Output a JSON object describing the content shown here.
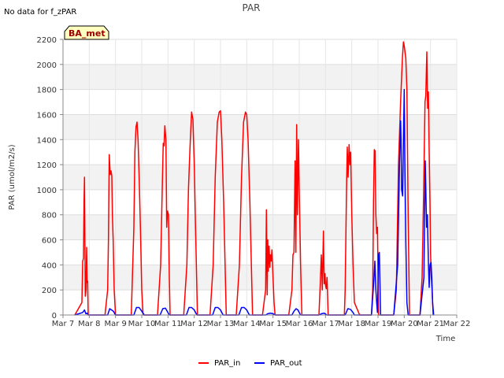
{
  "chart_data": {
    "type": "line",
    "title": "PAR",
    "note": "No data for f_zPAR",
    "badge": "BA_met",
    "xlabel": "Time",
    "ylabel": "PAR (umol/m2/s)",
    "xlim": [
      7,
      22
    ],
    "ylim": [
      0,
      2200
    ],
    "x_ticks": [
      7,
      8,
      9,
      10,
      11,
      12,
      13,
      14,
      15,
      16,
      17,
      18,
      19,
      20,
      21,
      22
    ],
    "x_tick_labels": [
      "Mar 7",
      "Mar 8",
      "Mar 9",
      "Mar 10",
      "Mar 11",
      "Mar 12",
      "Mar 13",
      "Mar 14",
      "Mar 15",
      "Mar 16",
      "Mar 17",
      "Mar 18",
      "Mar 19",
      "Mar 20",
      "Mar 21",
      "Mar 22"
    ],
    "y_ticks": [
      0,
      200,
      400,
      600,
      800,
      1000,
      1200,
      1400,
      1600,
      1800,
      2000,
      2200
    ],
    "y_tick_labels": [
      "0",
      "200",
      "400",
      "600",
      "800",
      "1000",
      "1200",
      "1400",
      "1600",
      "1800",
      "2000",
      "2200"
    ],
    "grid": true,
    "legend_position": "bottom-center",
    "series": [
      {
        "name": "PAR_in",
        "color": "#ff0000",
        "x": [
          7.45,
          7.72,
          7.75,
          7.78,
          7.8,
          7.82,
          7.85,
          7.88,
          7.9,
          7.92,
          7.94,
          7.96,
          8.0,
          8.02,
          8.05,
          8.08,
          8.1,
          8.3,
          8.6,
          8.7,
          8.73,
          8.76,
          8.8,
          8.83,
          8.86,
          8.88,
          8.91,
          8.95,
          9.0,
          9.1,
          9.3,
          9.6,
          9.7,
          9.74,
          9.78,
          9.82,
          9.86,
          9.9,
          9.95,
          10.0,
          10.05,
          10.1,
          10.3,
          10.6,
          10.72,
          10.78,
          10.82,
          10.85,
          10.88,
          10.92,
          10.95,
          10.98,
          11.02,
          11.05,
          11.08,
          11.3,
          11.6,
          11.72,
          11.78,
          11.82,
          11.85,
          11.9,
          11.95,
          12.0,
          12.05,
          12.12,
          12.22,
          12.35,
          12.6,
          12.72,
          12.8,
          12.88,
          12.95,
          13.0,
          13.05,
          13.12,
          13.22,
          13.35,
          13.6,
          13.72,
          13.8,
          13.88,
          13.95,
          14.0,
          14.05,
          14.12,
          14.22,
          14.35,
          14.6,
          14.72,
          14.75,
          14.78,
          14.8,
          14.82,
          14.85,
          14.88,
          14.9,
          14.93,
          14.96,
          15.0,
          15.04,
          15.08,
          15.12,
          15.3,
          15.6,
          15.72,
          15.76,
          15.8,
          15.84,
          15.87,
          15.9,
          15.93,
          15.97,
          16.0,
          16.05,
          16.1,
          16.3,
          16.6,
          16.75,
          16.8,
          16.84,
          16.88,
          16.92,
          16.95,
          16.98,
          17.0,
          17.03,
          17.06,
          17.1,
          17.3,
          17.6,
          17.72,
          17.75,
          17.8,
          17.83,
          17.86,
          17.9,
          17.93,
          17.96,
          18.0,
          18.05,
          18.1,
          18.3,
          18.65,
          18.75,
          18.8,
          18.83,
          18.86,
          18.89,
          18.92,
          18.95,
          18.98,
          19.02,
          19.05,
          19.08,
          19.3,
          19.6,
          19.7,
          19.78,
          19.86,
          19.93,
          19.97,
          20.0,
          20.03,
          20.06,
          20.1,
          20.15,
          20.2,
          20.3,
          20.6,
          20.68,
          20.74,
          20.79,
          20.82,
          20.86,
          20.89,
          20.92,
          20.95,
          20.98,
          21.0,
          21.03,
          21.06,
          21.1,
          21.12
        ],
        "y": [
          0,
          100,
          430,
          450,
          900,
          1100,
          150,
          200,
          540,
          260,
          270,
          0,
          0,
          0,
          0,
          0,
          0,
          0,
          0,
          200,
          600,
          1280,
          1120,
          1150,
          1110,
          800,
          600,
          200,
          0,
          0,
          0,
          0,
          700,
          1300,
          1500,
          1540,
          1400,
          1100,
          700,
          200,
          0,
          0,
          0,
          0,
          400,
          1000,
          1370,
          1350,
          1510,
          1400,
          700,
          830,
          800,
          300,
          0,
          0,
          0,
          400,
          1000,
          1240,
          1400,
          1620,
          1560,
          1200,
          700,
          0,
          0,
          0,
          0,
          400,
          1100,
          1540,
          1620,
          1630,
          1400,
          900,
          0,
          0,
          0,
          400,
          1100,
          1540,
          1620,
          1600,
          1400,
          900,
          0,
          0,
          0,
          200,
          840,
          160,
          600,
          350,
          550,
          380,
          480,
          430,
          520,
          300,
          100,
          0,
          0,
          0,
          0,
          200,
          480,
          500,
          1230,
          500,
          1520,
          800,
          1400,
          1000,
          400,
          0,
          0,
          0,
          0,
          250,
          480,
          200,
          670,
          250,
          330,
          240,
          210,
          300,
          0,
          0,
          0,
          0,
          200,
          1000,
          1340,
          1100,
          1360,
          1200,
          1300,
          800,
          400,
          100,
          0,
          0,
          0,
          200,
          900,
          1320,
          1310,
          800,
          650,
          700,
          0,
          0,
          0,
          0,
          0,
          200,
          1200,
          1700,
          2050,
          2180,
          2150,
          2100,
          2050,
          1800,
          800,
          0,
          0,
          0,
          300,
          1000,
          1700,
          1750,
          2100,
          1650,
          1780,
          1300,
          900,
          500,
          300,
          200,
          0,
          0
        ]
      },
      {
        "name": "PAR_out",
        "color": "#0000ff",
        "x": [
          7.45,
          7.75,
          7.82,
          7.87,
          7.92,
          7.96,
          8.0,
          8.1,
          8.7,
          8.78,
          8.85,
          8.92,
          9.0,
          9.1,
          9.7,
          9.8,
          9.9,
          10.0,
          10.1,
          10.7,
          10.8,
          10.9,
          10.97,
          11.05,
          11.7,
          11.8,
          11.9,
          12.0,
          12.1,
          12.7,
          12.8,
          12.9,
          13.0,
          13.1,
          13.7,
          13.8,
          13.9,
          14.0,
          14.1,
          14.72,
          14.8,
          14.9,
          15.0,
          15.1,
          15.72,
          15.8,
          15.88,
          15.95,
          16.05,
          16.75,
          16.85,
          16.95,
          17.05,
          17.75,
          17.85,
          17.95,
          18.05,
          18.1,
          18.75,
          18.85,
          18.88,
          18.92,
          18.95,
          18.98,
          19.02,
          19.05,
          19.1,
          19.6,
          19.75,
          19.82,
          19.86,
          19.88,
          19.9,
          19.94,
          19.97,
          20.0,
          20.03,
          20.06,
          20.1,
          20.15,
          20.6,
          20.75,
          20.8,
          20.85,
          20.88,
          20.92,
          20.95,
          20.98,
          21.02,
          21.05,
          21.08,
          21.12
        ],
        "y": [
          0,
          20,
          40,
          10,
          15,
          0,
          0,
          0,
          0,
          50,
          40,
          30,
          0,
          0,
          0,
          60,
          60,
          30,
          0,
          0,
          50,
          55,
          30,
          0,
          0,
          60,
          60,
          40,
          0,
          0,
          60,
          60,
          40,
          0,
          0,
          60,
          60,
          40,
          0,
          0,
          10,
          15,
          10,
          0,
          0,
          30,
          50,
          40,
          0,
          0,
          10,
          15,
          0,
          0,
          50,
          45,
          20,
          0,
          0,
          300,
          430,
          200,
          100,
          20,
          480,
          500,
          0,
          0,
          400,
          1200,
          1550,
          1400,
          1000,
          950,
          1400,
          1800,
          1100,
          600,
          100,
          0,
          0,
          300,
          1230,
          700,
          800,
          420,
          220,
          400,
          420,
          300,
          100,
          0
        ]
      }
    ]
  }
}
